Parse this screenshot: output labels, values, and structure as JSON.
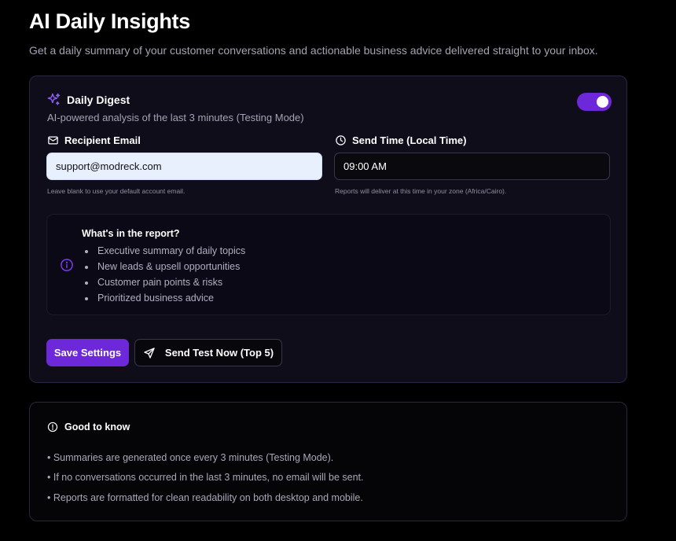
{
  "page": {
    "title": "AI Daily Insights",
    "subtitle": "Get a daily summary of your customer conversations and actionable business advice delivered straight to your inbox."
  },
  "digest": {
    "title": "Daily Digest",
    "description": "AI-powered analysis of the last 3 minutes (Testing Mode)",
    "enabled": true,
    "icon": "sparkles-icon"
  },
  "recipient": {
    "label": "Recipient Email",
    "value": "support@modreck.com",
    "hint": "Leave blank to use your default account email.",
    "icon": "mail-icon"
  },
  "send_time": {
    "label": "Send Time (Local Time)",
    "value": "09:00 AM",
    "hint": "Reports will deliver at this time in your zone (Africa/Cairo).",
    "icon": "clock-icon"
  },
  "report": {
    "title": "What's in the report?",
    "items": [
      "Executive summary of daily topics",
      "New leads & upsell opportunities",
      "Customer pain points & risks",
      "Prioritized business advice"
    ]
  },
  "actions": {
    "save_label": "Save Settings",
    "test_label": "Send Test Now (Top 5)"
  },
  "good_to_know": {
    "title": "Good to know",
    "lines": [
      "• Summaries are generated once every 3 minutes (Testing Mode).",
      "• If no conversations occurred in the last 3 minutes, no email will be sent.",
      "• Reports are formatted for clean readability on both desktop and mobile."
    ]
  },
  "colors": {
    "accent": "#6d28d9",
    "background": "#000000",
    "card": "#100d1b"
  }
}
